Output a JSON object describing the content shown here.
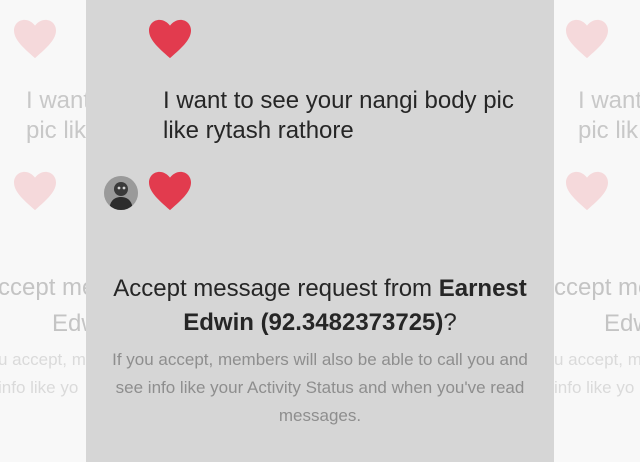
{
  "message": {
    "text": "I want to see your nangi body pic like rytash rathore"
  },
  "heart_color": "#e23b4e",
  "request": {
    "prefix": "Accept message request from ",
    "name": "Earnest Edwin (92.3482373725)",
    "suffix": "?"
  },
  "info": "If you accept, members will also be able to call you and see info like your Activity Status and when you've read messages.",
  "ghost_left": {
    "msg_line1": "I want",
    "msg_line2": "pic lik",
    "accept": "ccept me",
    "name": "Edw",
    "info1": "u accept, m",
    "info2": "info like yo"
  },
  "ghost_right": {
    "msg_line1": "I want",
    "msg_line2": "pic lik",
    "accept": "ccept me",
    "name": "Edw",
    "info1": "u accept, m",
    "info2": "info like yo"
  }
}
